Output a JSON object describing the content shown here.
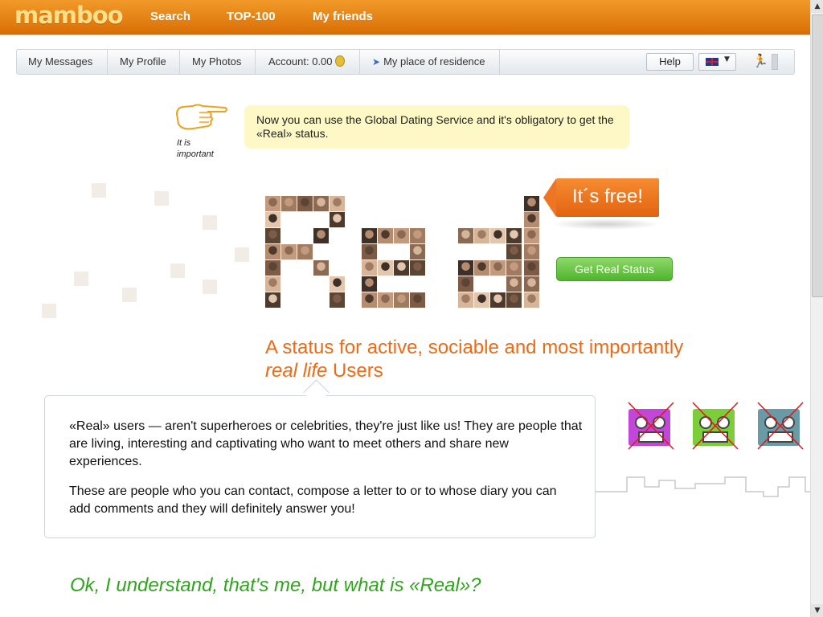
{
  "header": {
    "logo": "mamboo",
    "nav": [
      "Search",
      "TOP-100",
      "My friends"
    ]
  },
  "subnav": {
    "items": [
      "My Messages",
      "My Profile",
      "My Photos"
    ],
    "account_label": "Account: 0.00",
    "residence": "My place of residence",
    "help": "Help"
  },
  "notice": {
    "important": "It is important",
    "text": "Now you can use the Global Dating Service and it's obligatory to get the «Real» status."
  },
  "promo": {
    "free": "It´s free!",
    "button": "Get Real Status",
    "headline_line1": "A status for active, sociable and most importantly",
    "headline_em": "real life",
    "headline_rest": " Users"
  },
  "info": {
    "para1": "«Real» users — aren't superheroes or celebrities, they're just like us! They are people that are living, interesting and captivating who want to meet others and share new experiences.",
    "para2": "These are people who you can contact, compose a letter to or to whose diary you can add comments and they will definitely answer you!"
  },
  "question": "Ok, I understand, that's me, but what is «Real»?",
  "colors": {
    "brand_orange": "#e07a10",
    "accent_orange": "#ee6a15",
    "green": "#2ea61b",
    "notice_bg": "#fdf8c5"
  },
  "icons": [
    "coin-icon",
    "location-arrow-icon",
    "uk-flag-icon",
    "runner-icon",
    "pointing-hand-icon"
  ]
}
